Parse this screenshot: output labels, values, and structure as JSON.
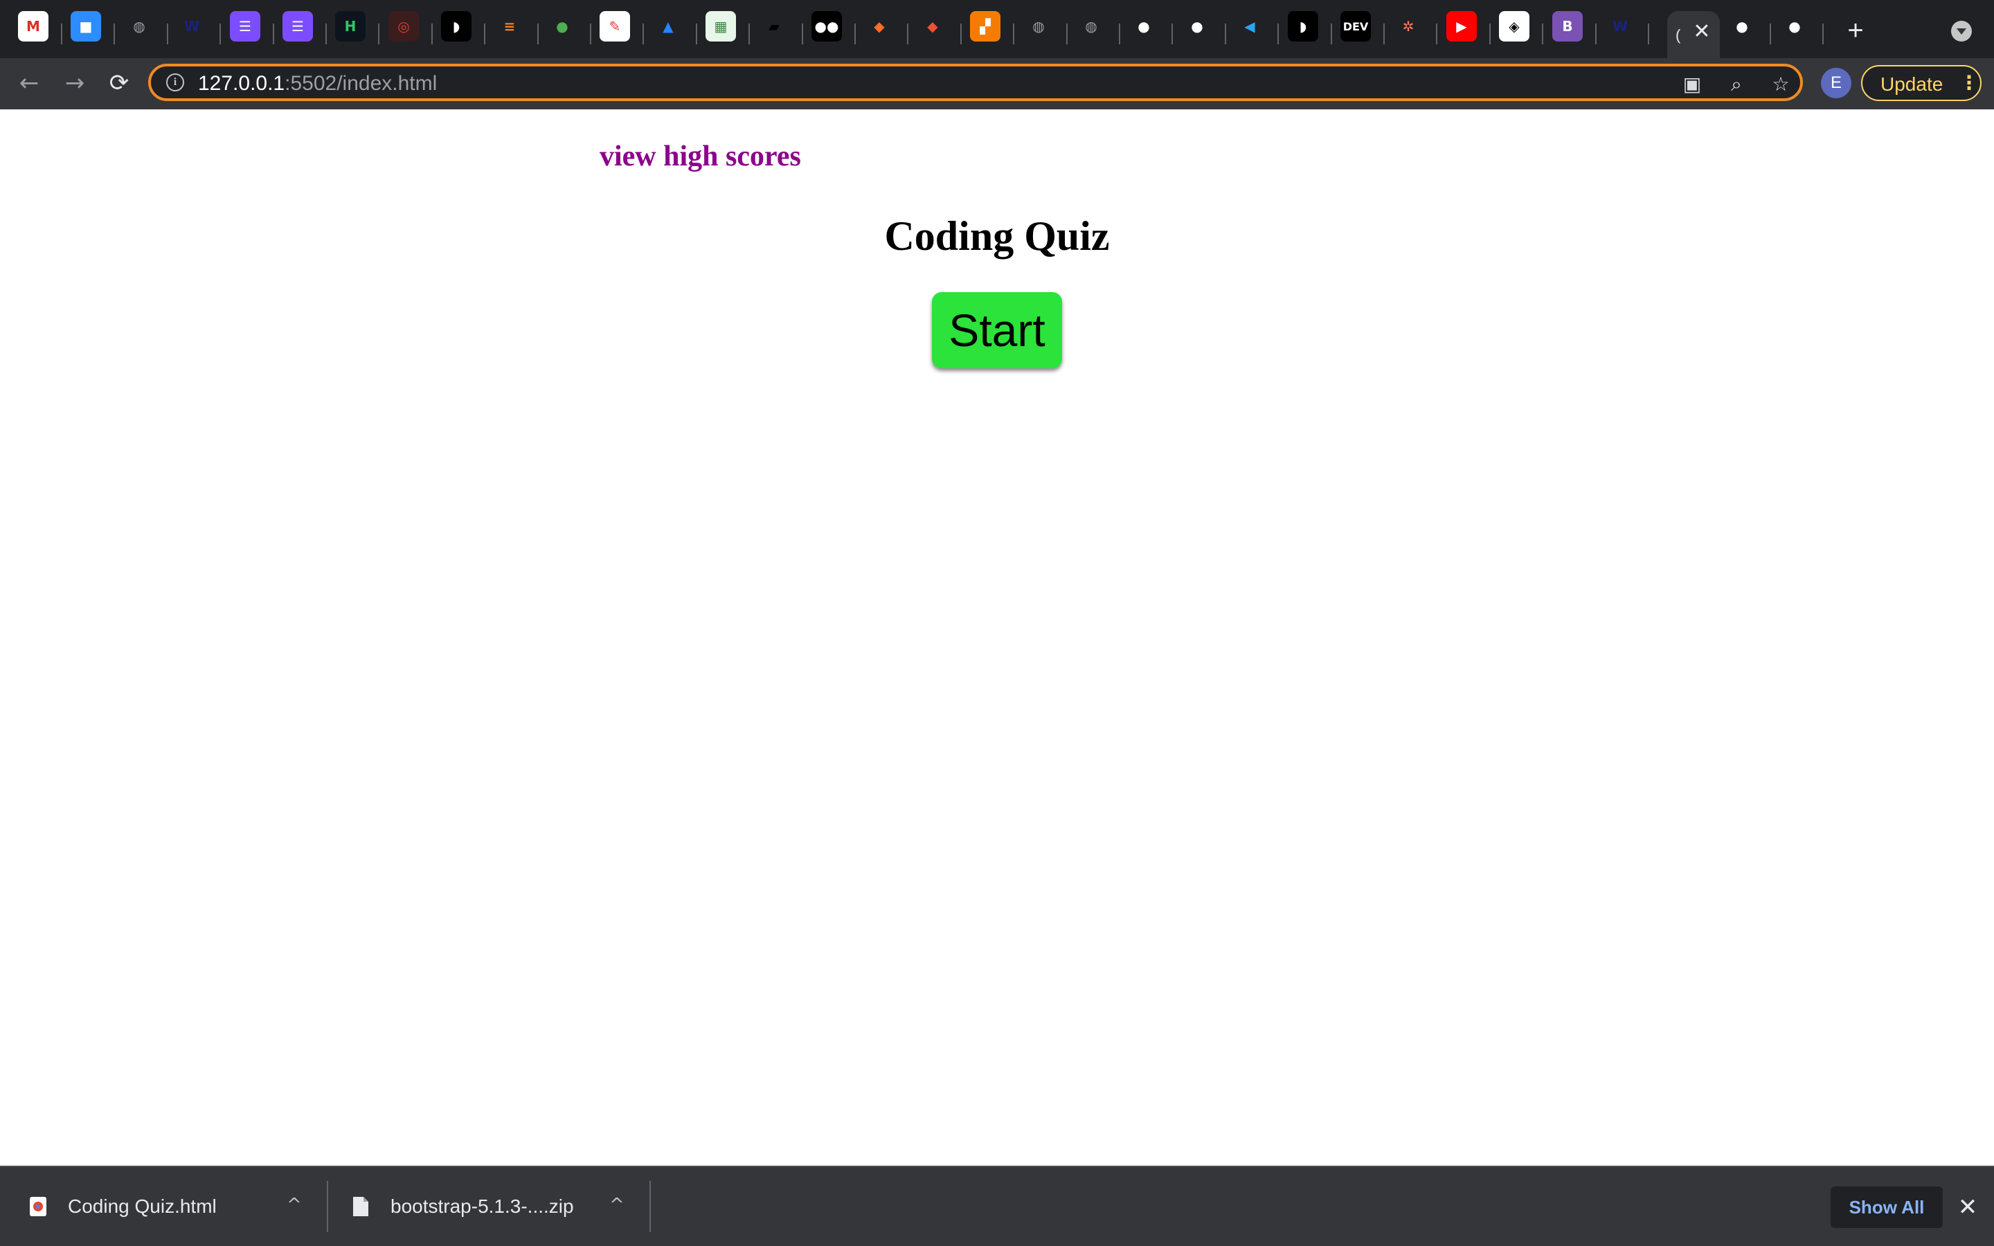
{
  "tabs": [
    {
      "name": "gmail",
      "glyph": "M",
      "bg": "#ffffff",
      "fg": "#d93025"
    },
    {
      "name": "zoom",
      "glyph": "■",
      "bg": "#2d8cff",
      "fg": "#ffffff"
    },
    {
      "name": "web",
      "glyph": "◍",
      "bg": "transparent",
      "fg": "#9aa0a6"
    },
    {
      "name": "wp",
      "glyph": "W",
      "bg": "transparent",
      "fg": "#1a237e"
    },
    {
      "name": "forms-1",
      "glyph": "☰",
      "bg": "#7c4dff",
      "fg": "#ffffff"
    },
    {
      "name": "forms-2",
      "glyph": "☰",
      "bg": "#7c4dff",
      "fg": "#ffffff"
    },
    {
      "name": "hackerrank",
      "glyph": "H",
      "bg": "#0e141e",
      "fg": "#2ec866"
    },
    {
      "name": "spiral",
      "glyph": "◎",
      "bg": "#3b1d1d",
      "fg": "#e53935"
    },
    {
      "name": "dino-1",
      "glyph": "◗",
      "bg": "#000000",
      "fg": "#ffffff"
    },
    {
      "name": "stackoverflow",
      "glyph": "≡",
      "bg": "transparent",
      "fg": "#f48024"
    },
    {
      "name": "frog",
      "glyph": "●",
      "bg": "transparent",
      "fg": "#4caf50"
    },
    {
      "name": "paint",
      "glyph": "✎",
      "bg": "#ffffff",
      "fg": "#e53935"
    },
    {
      "name": "atlassian",
      "glyph": "▲",
      "bg": "transparent",
      "fg": "#2684ff"
    },
    {
      "name": "chart",
      "glyph": "▦",
      "bg": "#e8f5e9",
      "fg": "#388e3c"
    },
    {
      "name": "book",
      "glyph": "▰",
      "bg": "transparent",
      "fg": "#000000"
    },
    {
      "name": "medium",
      "glyph": "●●",
      "bg": "#000000",
      "fg": "#ffffff"
    },
    {
      "name": "gitlab",
      "glyph": "◆",
      "bg": "transparent",
      "fg": "#fc6d26"
    },
    {
      "name": "git",
      "glyph": "◆",
      "bg": "transparent",
      "fg": "#f05032"
    },
    {
      "name": "orange-app",
      "glyph": "▞",
      "bg": "#f57c00",
      "fg": "#ffffff"
    },
    {
      "name": "web-2",
      "glyph": "◍",
      "bg": "transparent",
      "fg": "#9aa0a6"
    },
    {
      "name": "web-3",
      "glyph": "◍",
      "bg": "transparent",
      "fg": "#9aa0a6"
    },
    {
      "name": "github-1",
      "glyph": "●",
      "bg": "transparent",
      "fg": "#ffffff"
    },
    {
      "name": "github-2",
      "glyph": "●",
      "bg": "transparent",
      "fg": "#ffffff"
    },
    {
      "name": "vscode",
      "glyph": "◀",
      "bg": "transparent",
      "fg": "#23a9f2"
    },
    {
      "name": "dino-2",
      "glyph": "◗",
      "bg": "#000000",
      "fg": "#ffffff"
    },
    {
      "name": "dev",
      "glyph": "DEV",
      "bg": "#000000",
      "fg": "#ffffff"
    },
    {
      "name": "hubspot",
      "glyph": "✲",
      "bg": "transparent",
      "fg": "#ff7a59"
    },
    {
      "name": "youtube",
      "glyph": "▶",
      "bg": "#ff0000",
      "fg": "#ffffff"
    },
    {
      "name": "codepen",
      "glyph": "◈",
      "bg": "#ffffff",
      "fg": "#000000"
    },
    {
      "name": "bootstrap",
      "glyph": "B",
      "bg": "#7952b3",
      "fg": "#ffffff"
    },
    {
      "name": "wp-2",
      "glyph": "W",
      "bg": "transparent",
      "fg": "#1a237e"
    }
  ],
  "tabs_after": [
    {
      "name": "github-3",
      "glyph": "●",
      "bg": "transparent",
      "fg": "#ffffff"
    },
    {
      "name": "github-4",
      "glyph": "●",
      "bg": "transparent",
      "fg": "#ffffff"
    }
  ],
  "active_tab": {
    "favicon": "(",
    "close": "✕"
  },
  "new_tab": "+",
  "toolbar": {
    "back": "←",
    "forward": "→",
    "reload": "⟳",
    "url_host": "127.0.0.1",
    "url_path": ":5502/index.html",
    "info_icon": "i",
    "avatar_initial": "E",
    "update_label": "Update",
    "menu_icon": "⋮"
  },
  "page": {
    "high_scores_link": "view high scores",
    "title": "Coding Quiz",
    "start_button": "Start"
  },
  "downloads": {
    "items": [
      {
        "name": "Coding Quiz.html"
      },
      {
        "name": "bootstrap-5.1.3-....zip"
      }
    ],
    "caret": "^",
    "show_all": "Show All",
    "close": "✕"
  },
  "colors": {
    "high_scores": "#8b008b",
    "start_bg": "#2be33a",
    "omnibox_focus": "#f08a24",
    "update_accent": "#fdd663"
  }
}
